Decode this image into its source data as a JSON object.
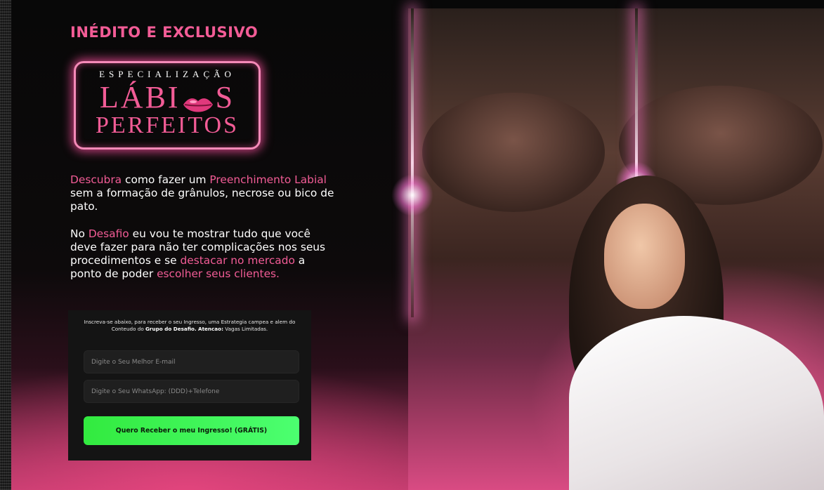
{
  "header": {
    "eyebrow": "INÉDITO E EXCLUSIVO"
  },
  "logo": {
    "line1": "ESPECIALIZAÇÃO",
    "line2_left": "LÁBI",
    "line2_right": "S",
    "line3": "PERFEITOS",
    "icon": "kiss-lips-icon"
  },
  "copy": {
    "p1": [
      {
        "text": "Descubra",
        "highlight": true
      },
      {
        "text": " como fazer um ",
        "highlight": false
      },
      {
        "text": "Preenchimento Labial",
        "highlight": true
      },
      {
        "text": " sem a formação de grânulos, necrose ou bico de pato.",
        "highlight": false
      }
    ],
    "p2": [
      {
        "text": "No ",
        "highlight": false
      },
      {
        "text": "Desafio",
        "highlight": true
      },
      {
        "text": " eu vou te mostrar tudo que você deve fazer para não ter complicações nos seus procedimentos e se ",
        "highlight": false
      },
      {
        "text": "destacar no mercado",
        "highlight": true
      },
      {
        "text": " a ponto de poder ",
        "highlight": false
      },
      {
        "text": "escolher seus clientes.",
        "highlight": true
      }
    ]
  },
  "form": {
    "intro_plain": "Inscreva-se abaixo, para receber o seu Ingresso, uma Estrategia campea e alem do Conteudo do ",
    "intro_bold1": "Grupo do Desafio.",
    "intro_bold2": "Atencao:",
    "intro_tail": " Vagas Limitadas.",
    "email_placeholder": "Digite o Seu Melhor E-mail",
    "whatsapp_placeholder": "Digite o Seu WhatsApp: (DDD)+Telefone",
    "submit_label": "Quero Receber o meu Ingresso! (GRÁTIS)"
  },
  "colors": {
    "accent_pink": "#f25c96",
    "cta_green": "#3cf25a",
    "background": "#0b0b0b"
  }
}
